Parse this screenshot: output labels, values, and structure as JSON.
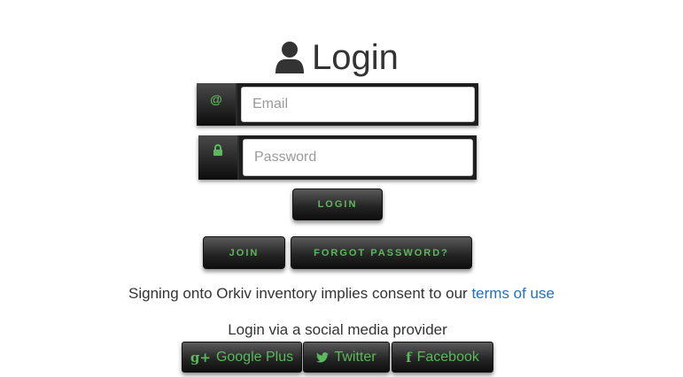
{
  "header": {
    "title": "Login",
    "icon": "user-icon"
  },
  "form": {
    "email": {
      "addon_symbol": "@",
      "placeholder": "Email",
      "value": ""
    },
    "password": {
      "addon_icon": "lock-icon",
      "placeholder": "Password",
      "value": ""
    },
    "login_label": "LOGIN",
    "join_label": "JOIN",
    "forgot_label": "FORGOT PASSWORD?"
  },
  "consent": {
    "text": "Signing onto Orkiv inventory implies consent to our",
    "link_text": "terms of use"
  },
  "social": {
    "label": "Login via a social media provider",
    "google": {
      "icon_glyph": "g+",
      "label": "Google Plus"
    },
    "twitter": {
      "icon": "twitter-icon",
      "label": "Twitter"
    },
    "facebook": {
      "icon_glyph": "f",
      "label": "Facebook"
    }
  },
  "colors": {
    "accent": "#5cb85c",
    "link": "#1f6fc5",
    "button_dark": "#1a1a1a"
  }
}
